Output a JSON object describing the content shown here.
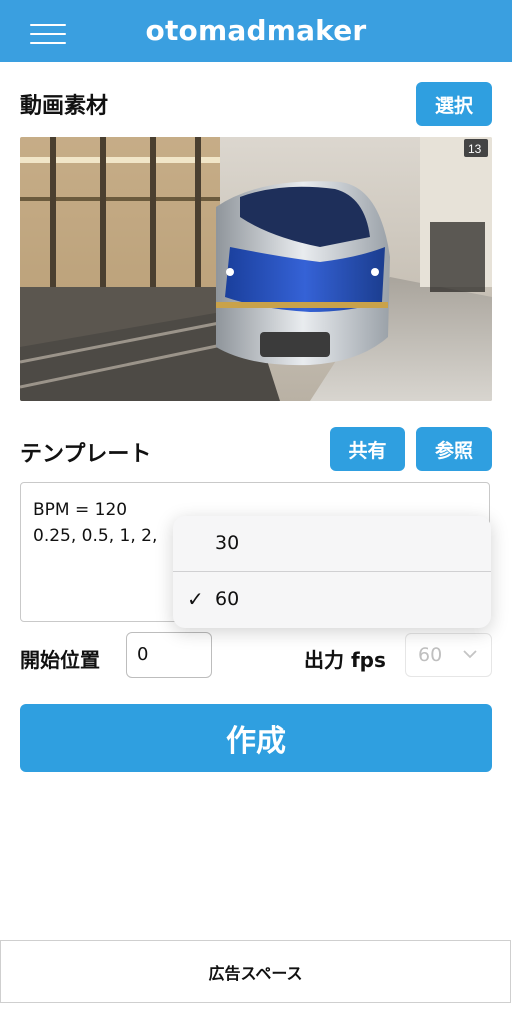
{
  "header": {
    "title": "otomadmaker",
    "menu_icon": "hamburger-icon",
    "color": "#3a9fe0"
  },
  "video_section": {
    "title": "動画素材",
    "select_label": "選択",
    "preview_sign": "13"
  },
  "template_section": {
    "title": "テンプレート",
    "share_label": "共有",
    "browse_label": "参照",
    "text": "BPM = 120\n0.25, 0.5, 1, 2,"
  },
  "start_position": {
    "label": "開始位置",
    "value": "0"
  },
  "output_fps": {
    "label": "出力 fps",
    "selected": "60",
    "options": [
      {
        "label": "30",
        "checked": false
      },
      {
        "label": "60",
        "checked": true
      }
    ],
    "check_glyph": "✓"
  },
  "create_label": "作成",
  "ad_label": "広告スペース",
  "accent_color": "#2f9fe0"
}
